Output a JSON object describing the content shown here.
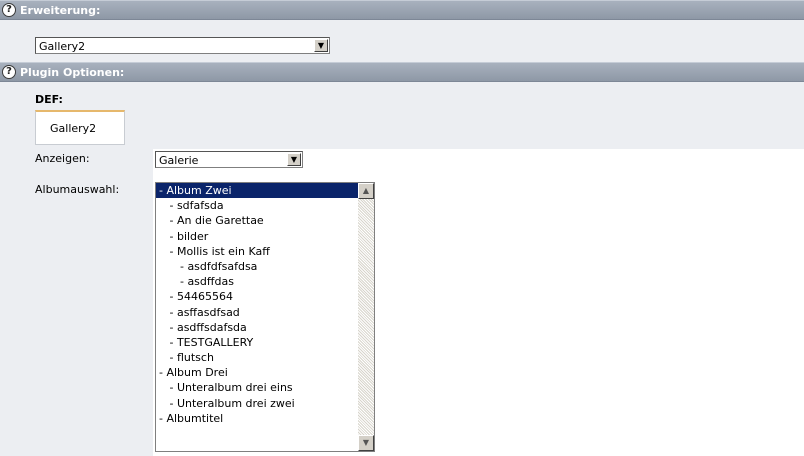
{
  "extension": {
    "title": "Erweiterung:",
    "help_icon": "?",
    "select_value": "Gallery2",
    "arrow": "▼"
  },
  "plugin": {
    "title": "Plugin Optionen:",
    "help_icon": "?",
    "def_label": "DEF:",
    "tab_label": "Gallery2",
    "anzeigen_label": "Anzeigen:",
    "anzeigen_value": "Galerie",
    "album_label": "Albumauswahl:",
    "album_items": [
      "- Album Zwei",
      "   - sdfafsda",
      "   - An die Garettae",
      "   - bilder",
      "   - Mollis ist ein Kaff",
      "      - asdfdfsafdsa",
      "      - asdffdas",
      "   - 54465564",
      "   - asffasdfsad",
      "   - asdffsdafsda",
      "   - TESTGALLERY",
      "   - flutsch",
      "- Album Drei",
      "   - Unteralbum drei eins",
      "   - Unteralbum drei zwei",
      "- Albumtitel"
    ],
    "selected_index": 0,
    "scroll_up": "▲",
    "scroll_down": "▼"
  }
}
